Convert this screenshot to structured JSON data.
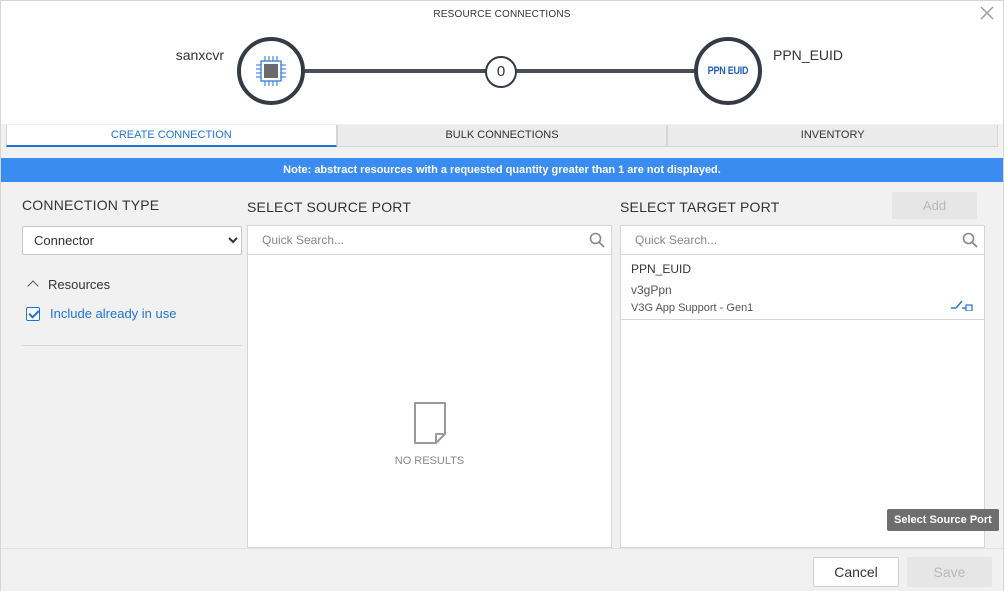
{
  "dialog": {
    "title": "RESOURCE CONNECTIONS",
    "close_icon": "close-icon"
  },
  "diagram": {
    "source_name": "sanxcvr",
    "target_name": "PPN_EUID",
    "target_badge": "PPN EUID",
    "connection_count": "0",
    "source_icon": "chip-icon"
  },
  "tabs": [
    {
      "label": "CREATE CONNECTION",
      "active": true
    },
    {
      "label": "BULK CONNECTIONS",
      "active": false
    },
    {
      "label": "INVENTORY",
      "active": false
    }
  ],
  "note": "Note: abstract resources with a requested quantity greater than 1 are not displayed.",
  "left": {
    "connection_type_title": "CONNECTION TYPE",
    "connection_type_value": "Connector",
    "resources_label": "Resources",
    "include_in_use_label": "Include already in use",
    "include_in_use_checked": true
  },
  "source": {
    "title": "SELECT SOURCE PORT",
    "search_placeholder": "Quick Search...",
    "empty_text": "NO RESULTS"
  },
  "target": {
    "title": "SELECT TARGET PORT",
    "search_placeholder": "Quick Search...",
    "add_label": "Add",
    "items": [
      {
        "name": "PPN_EUID",
        "sub": "v3gPpn",
        "desc": "V3G App Support - Gen1"
      }
    ]
  },
  "tooltip": "Select Source Port",
  "footer": {
    "cancel_label": "Cancel",
    "save_label": "Save"
  },
  "colors": {
    "accent": "#1f73d6",
    "note_bg": "#3b8cf0",
    "node_border": "#353a44"
  }
}
